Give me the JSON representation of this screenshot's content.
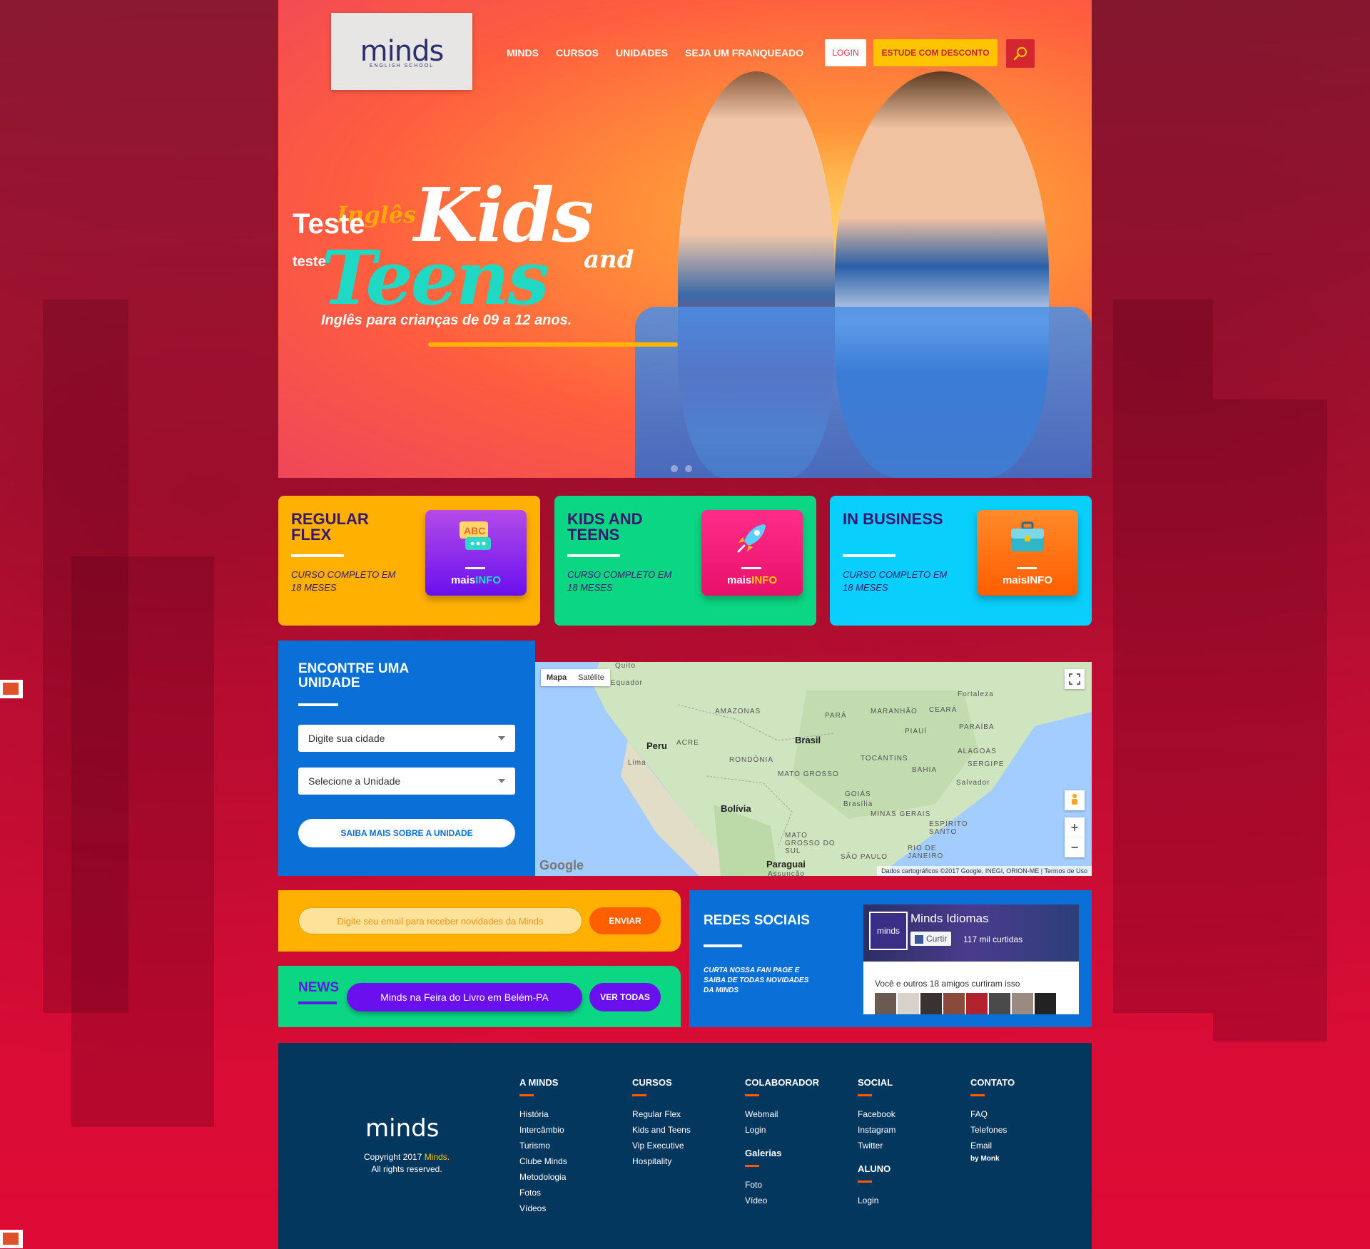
{
  "header": {
    "logo_text": "minds",
    "logo_sub": "ENGLISH SCHOOL",
    "nav": [
      "MINDS",
      "CURSOS",
      "UNIDADES",
      "SEJA UM FRANQUEADO"
    ],
    "login_label": "LOGIN",
    "desconto_label": "ESTUDE COM DESCONTO"
  },
  "hero": {
    "teste": "Teste",
    "teste_small": "teste",
    "ingles": "Inglês",
    "kids": "Kids",
    "and": "and",
    "teens": "Teens",
    "subtitle": "Inglês para crianças de 09 a 12 anos."
  },
  "courses": [
    {
      "title": "REGULAR FLEX",
      "desc": "CURSO COMPLETO EM 18 MESES",
      "mais": "mais",
      "info": "INFO",
      "color": "#ffb000"
    },
    {
      "title": "KIDS AND TEENS",
      "desc": "CURSO COMPLETO EM 18 MESES",
      "mais": "mais",
      "info": "INFO",
      "color": "#0bd684"
    },
    {
      "title": "IN BUSINESS",
      "desc": "CURSO COMPLETO EM 18 MESES",
      "mais": "mais",
      "info": "INFO",
      "color": "#08cffb"
    }
  ],
  "unit": {
    "title": "ENCONTRE UMA UNIDADE",
    "city_placeholder": "Digite sua cidade",
    "unit_placeholder": "Selecione a Unidade",
    "saiba_label": "SAIBA MAIS SOBRE A UNIDADE"
  },
  "map": {
    "tab_map": "Mapa",
    "tab_sat": "Satélite",
    "labels": [
      "Quito",
      "Equador",
      "Fortaleza",
      "AMAZONAS",
      "PARÁ",
      "MARANHÃO",
      "CEARÁ",
      "PIAUÍ",
      "PARAÍBA",
      "Peru",
      "ACRE",
      "Brasil",
      "ALAGOAS",
      "Lima",
      "RONDÔNIA",
      "TOCANTINS",
      "SERGIPE",
      "BAHIA",
      "MATO GROSSO",
      "Salvador",
      "Bolívia",
      "GOIÁS",
      "Brasília",
      "MINAS GERAIS",
      "ESPÍRITO SANTO",
      "MATO GROSSO DO SUL",
      "SÃO PAULO",
      "RIO DE JANEIRO",
      "Paraguai",
      "Assunção"
    ],
    "credit": "Dados cartográficos ©2017 Google, INEGI, ORION-ME",
    "terms": "Termos de Uso",
    "google": "Google"
  },
  "newsletter": {
    "placeholder": "Digite seu email para receber novidades da Minds",
    "send_label": "ENVIAR"
  },
  "news": {
    "title": "NEWS",
    "item": "Minds na Feira do Livro em Belém-PA",
    "ver_label": "VER TODAS"
  },
  "social": {
    "title": "REDES SOCIAIS",
    "desc": "CURTA NOSSA FAN PAGE E SAIBA DE TODAS NOVIDADES DA MINDS",
    "fb_name": "Minds Idiomas",
    "fb_logo": "minds",
    "fb_like": "Curtir",
    "fb_count": "117 mil curtidas",
    "fb_friends": "Você e outros 18 amigos curtiram isso"
  },
  "footer": {
    "logo": "minds",
    "copy1": "Copyright 2017 ",
    "copy_brand": "Minds.",
    "copy2": "All rights reserved.",
    "cols": [
      {
        "head": "A MINDS",
        "links": [
          "História",
          "Intercâmbio",
          "Turismo",
          "Clube Minds",
          "Metodologia",
          "Fotos",
          "Vídeos"
        ]
      },
      {
        "head": "CURSOS",
        "links": [
          "Regular Flex",
          "Kids and Teens",
          "Vip Executive",
          "Hospitality"
        ]
      },
      {
        "head": "COLABORADOR",
        "links": [
          "Webmail",
          "Login"
        ],
        "sub_head": "Galerias",
        "sub_links": [
          "Foto",
          "Vídeo"
        ]
      },
      {
        "head": "SOCIAL",
        "links": [
          "Facebook",
          "Instagram",
          "Twitter"
        ],
        "sub_head": "ALUNO",
        "sub_links": [
          "Login"
        ]
      },
      {
        "head": "CONTATO",
        "links": [
          "FAQ",
          "Telefones",
          "Email"
        ],
        "small": "by Monk"
      }
    ]
  }
}
